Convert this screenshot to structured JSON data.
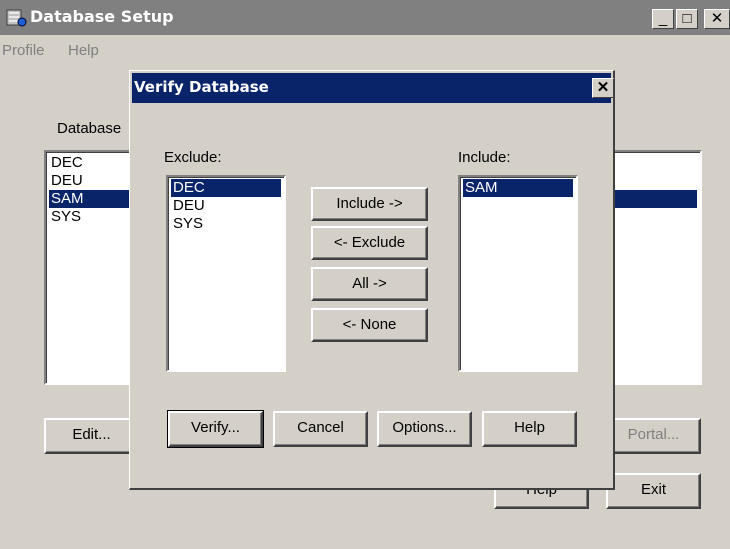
{
  "window": {
    "title": "Database Setup",
    "minimize_glyph": "_",
    "maximize_glyph": "□",
    "close_glyph": "✕",
    "icon": "database-app-icon"
  },
  "menu": {
    "items": [
      "Profile",
      "Help"
    ]
  },
  "main": {
    "database_label": "Database",
    "databases": [
      {
        "label": "DEC",
        "selected": false
      },
      {
        "label": "DEU",
        "selected": false
      },
      {
        "label": "SAM",
        "selected": true
      },
      {
        "label": "SYS",
        "selected": false
      }
    ],
    "buttons": {
      "edit": "Edit...",
      "portal": "Portal...",
      "help": "Help",
      "exit": "Exit"
    }
  },
  "dialog": {
    "title": "Verify Database",
    "close_glyph": "✕",
    "exclude_label": "Exclude:",
    "include_label": "Include:",
    "exclude_items": [
      {
        "label": "DEC",
        "selected": true
      },
      {
        "label": "DEU",
        "selected": false
      },
      {
        "label": "SYS",
        "selected": false
      }
    ],
    "include_items": [
      {
        "label": "SAM",
        "selected": true
      }
    ],
    "transfer_buttons": {
      "include": "Include ->",
      "exclude": "<- Exclude",
      "all": "All ->",
      "none": "<- None"
    },
    "buttons": {
      "verify": "Verify...",
      "cancel": "Cancel",
      "options": "Options...",
      "help": "Help"
    }
  },
  "colors": {
    "face": "#d4d0c8",
    "selection": "#0a246a",
    "inactive_title": "#808080"
  }
}
